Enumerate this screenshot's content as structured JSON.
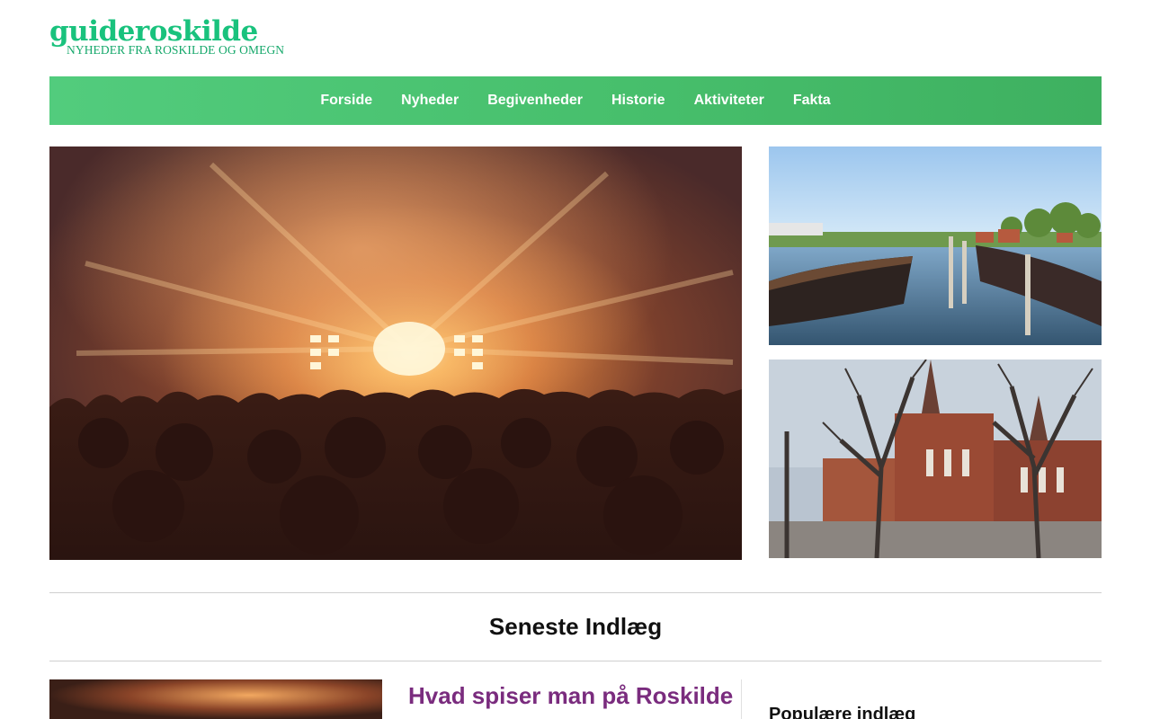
{
  "logo": {
    "main": "guideroskilde",
    "sub": "NYHEDER FRA ROSKILDE OG OMEGN"
  },
  "nav": {
    "items": [
      "Forside",
      "Nyheder",
      "Begivenheder",
      "Historie",
      "Aktiviteter",
      "Fakta"
    ]
  },
  "featured": {
    "hero_image": "concert-crowd-image",
    "side_images": [
      "harbor-boats-image",
      "roskilde-cathedral-image"
    ]
  },
  "latest": {
    "heading": "Seneste Indlæg"
  },
  "post": {
    "title": "Hvad spiser man på Roskilde",
    "thumb": "concert-thumbnail-image"
  },
  "sidebar": {
    "heading": "Populære indlæg"
  },
  "colors": {
    "nav_bg": "#4cc474",
    "logo_green": "#19c27d",
    "post_title": "#7a2c7e"
  }
}
